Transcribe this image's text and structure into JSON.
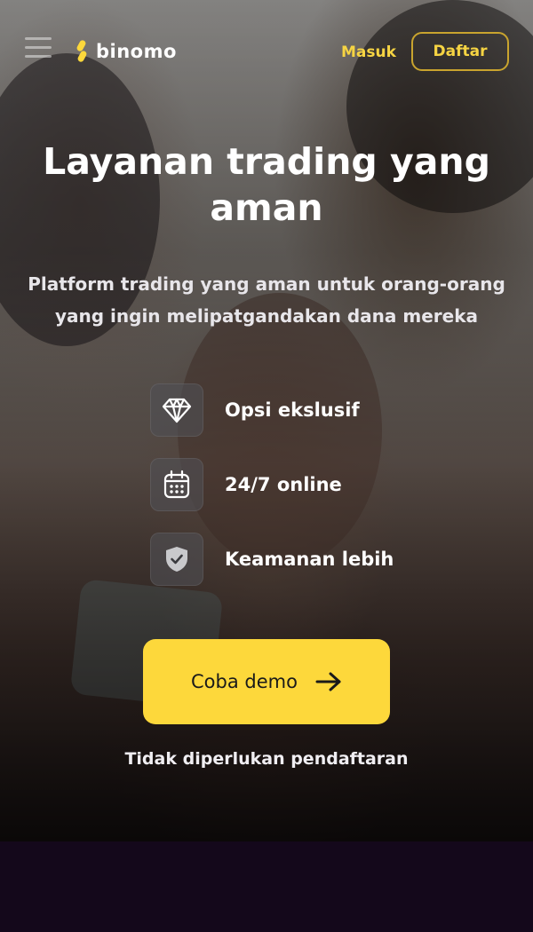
{
  "header": {
    "logo_text": "binomo",
    "login_label": "Masuk",
    "signup_label": "Daftar"
  },
  "hero": {
    "title": "Layanan trading yang aman",
    "subtitle": "Platform trading yang aman untuk orang-orang yang ingin melipatgandakan dana mereka",
    "features": [
      {
        "icon": "diamond-icon",
        "label": "Opsi ekslusif"
      },
      {
        "icon": "calendar-icon",
        "label": "24/7 online"
      },
      {
        "icon": "shield-check-icon",
        "label": "Keamanan lebih"
      }
    ],
    "cta_label": "Coba demo",
    "cta_note": "Tidak diperlukan pendaftaran"
  },
  "colors": {
    "accent": "#fdd83b",
    "accent_text": "#f6d443",
    "bottom_bg": "#14081b"
  }
}
